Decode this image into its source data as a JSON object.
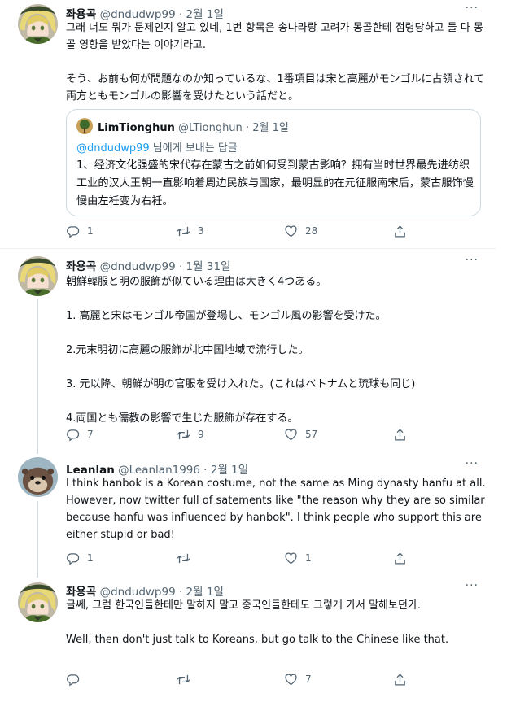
{
  "tweets": [
    {
      "name": "좌용곡",
      "handle": "@dndudwp99",
      "date": "· 2월 1일",
      "more": "···",
      "text": "그래 너도 뭐가 문제인지 알고 있네, 1번 항목은 송나라랑 고려가 몽골한테 점령당하고 둘 다 몽골 영향을 받았다는 이야기라고.\n\nそう、お前も何が問題なのか知っているな、1番項目は宋と高麗がモンゴルに占領されて両方ともモンゴルの影響を受けたという話だと。",
      "quote": {
        "name": "LimTionghun",
        "handle": "@LTionghun",
        "date": "· 2월 1일",
        "reply_prefix": "@dndudwp99",
        "reply_suffix": " 님에게 보내는 답글",
        "text": "1、经济文化强盛的宋代存在蒙古之前如何受到蒙古影响？拥有当时世界最先进纺织工业的汉人王朝一直影响着周边民族与国家，最明显的在元征服南宋后，蒙古服饰慢慢由左衽变为右衽。"
      },
      "replies": "1",
      "retweets": "3",
      "likes": "28"
    },
    {
      "name": "좌용곡",
      "handle": "@dndudwp99",
      "date": "· 1월 31일",
      "more": "···",
      "text": "朝鮮韓服と明の服飾が似ている理由は大きく4つある。\n\n1. 高麗と宋はモンゴル帝国が登場し、モンゴル風の影響を受けた。\n\n2.元末明初に高麗の服飾が北中国地域で流行した。\n\n3. 元以降、朝鮮が明の官服を受け入れた。(これはベトナムと琉球も同じ)\n\n4.両国とも儒教の影響で生じた服飾が存在する。",
      "replies": "7",
      "retweets": "9",
      "likes": "57"
    },
    {
      "name": "Leanlan",
      "handle": "@Leanlan1996",
      "date": "· 2월 1일",
      "more": "···",
      "text": "I think hanbok is a Korean costume, not the same as Ming dynasty hanfu at all. However, now twitter full of satements like \"the reason why they are so similar because hanfu was influenced by hanbok\". I think people who support this are either stupid or bad!",
      "replies": "1",
      "retweets": "",
      "likes": "1"
    },
    {
      "name": "좌용곡",
      "handle": "@dndudwp99",
      "date": "· 2월 1일",
      "more": "···",
      "text": "글쎄, 그럼 한국인들한테만 말하지 말고 중국인들한테도 그렇게 가서 말해보던가.\n\nWell, then don't just talk to Koreans, but go talk to the Chinese like that.",
      "replies": "",
      "retweets": "",
      "likes": "7"
    }
  ],
  "colors": {
    "text": "#0f1419",
    "muted": "#536471",
    "accent": "#1d9bf0",
    "border": "#cfd9de"
  },
  "icons": [
    "reply-icon",
    "retweet-icon",
    "like-icon",
    "share-icon",
    "more-icon"
  ]
}
